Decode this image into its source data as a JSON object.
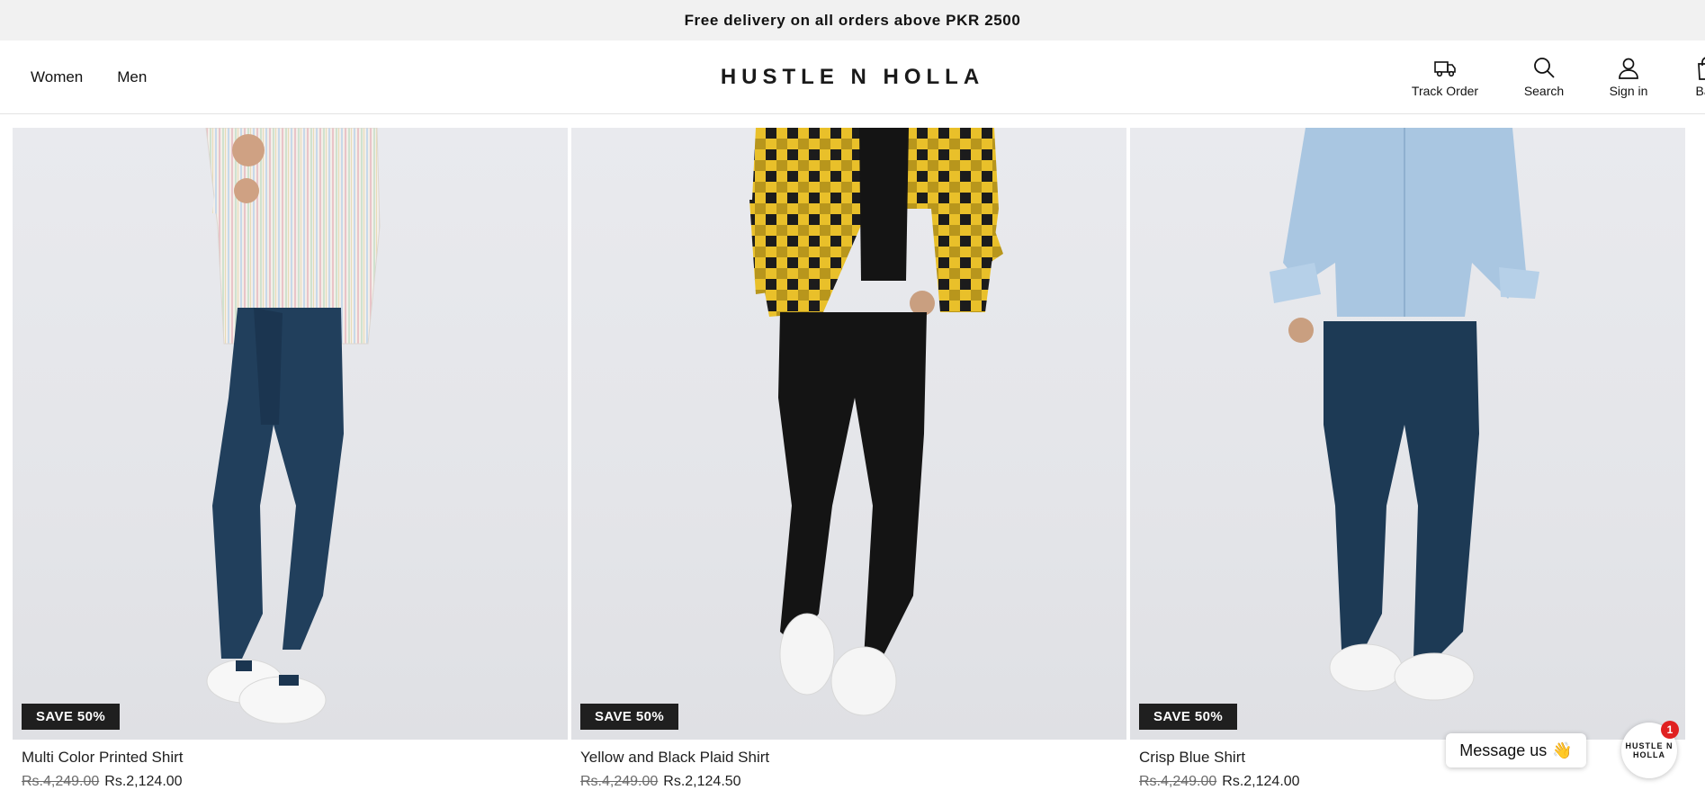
{
  "announcement": "Free delivery on all orders above PKR 2500",
  "nav": {
    "items": [
      "Women",
      "Men"
    ]
  },
  "brand": "HUSTLE N HOLLA",
  "actions": {
    "track": "Track Order",
    "search": "Search",
    "signin": "Sign in",
    "bag": "Bag"
  },
  "products": [
    {
      "badge": "SAVE 50%",
      "title": "Multi Color Printed Shirt",
      "old_price": "Rs.4,249.00",
      "price": "Rs.2,124.00"
    },
    {
      "badge": "SAVE 50%",
      "title": "Yellow and Black Plaid Shirt",
      "old_price": "Rs.4,249.00",
      "price": "Rs.2,124.50"
    },
    {
      "badge": "SAVE 50%",
      "title": "Crisp Blue Shirt",
      "old_price": "Rs.4,249.00",
      "price": "Rs.2,124.00"
    }
  ],
  "chat": {
    "label": "Message us",
    "emoji": "👋",
    "logo": "HUSTLE N HOLLA",
    "unread": "1"
  },
  "colors": {
    "announcement_bg": "#f1f1f1",
    "badge_bg": "#1f1f1f",
    "notification": "#e02020",
    "jeans_dark": "#1d3a55",
    "plaid_yellow": "#e9c02a",
    "shirt_blue": "#a9c6e1"
  }
}
